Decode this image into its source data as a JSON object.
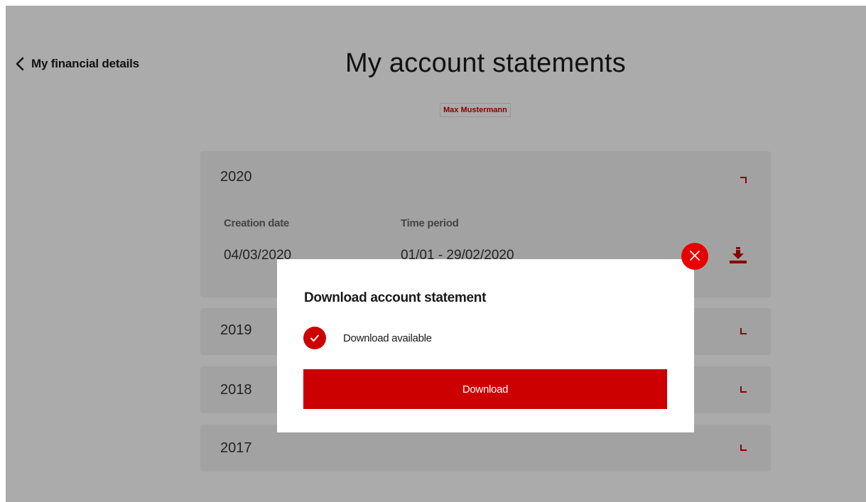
{
  "nav": {
    "back_label": "My financial details"
  },
  "header": {
    "title": "My account statements",
    "account_holder": "Max Mustermann"
  },
  "statements": {
    "columns": {
      "creation_date": "Creation date",
      "time_period": "Time period"
    },
    "years": [
      {
        "year": "2020",
        "expanded": true,
        "rows": [
          {
            "creation_date": "04/03/2020",
            "time_period": "01/01 - 29/02/2020"
          }
        ]
      },
      {
        "year": "2019",
        "expanded": false
      },
      {
        "year": "2018",
        "expanded": false
      },
      {
        "year": "2017",
        "expanded": false
      }
    ]
  },
  "modal": {
    "title": "Download account statement",
    "status_text": "Download available",
    "download_label": "Download"
  },
  "icons": {
    "back": "chevron-left-icon",
    "expand": "chevron-down-icon",
    "collapse": "chevron-up-icon",
    "download": "download-icon",
    "close": "close-icon",
    "status": "check-circle-icon"
  },
  "colors": {
    "accent": "#cc0000",
    "close_button": "#e60000",
    "panel_background": "#f2f2f2",
    "overlay": "rgba(0,0,0,0.33)"
  }
}
